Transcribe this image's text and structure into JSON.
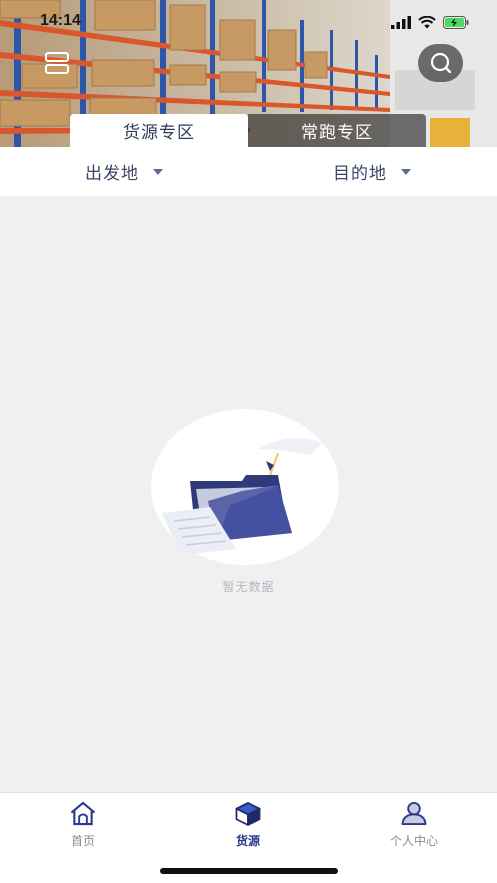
{
  "status_bar": {
    "time": "14:14"
  },
  "header": {
    "tabs": [
      {
        "label": "货源专区",
        "active": true
      },
      {
        "label": "常跑专区",
        "active": false
      }
    ],
    "menu_icon": "list-icon",
    "search_icon": "search-icon"
  },
  "filters": {
    "origin": "出发地",
    "destination": "目的地"
  },
  "empty_state": {
    "message": "暂无数据",
    "illustration": "empty-folder-illustration"
  },
  "tabbar": {
    "items": [
      {
        "label": "首页",
        "icon": "home-icon",
        "active": false
      },
      {
        "label": "货源",
        "icon": "box-icon",
        "active": true
      },
      {
        "label": "个人中心",
        "icon": "user-icon",
        "active": false
      }
    ]
  },
  "colors": {
    "accent": "#2a3b8f",
    "background": "#f0f0f0",
    "tab_text": "#2e3a59",
    "filter_text": "#3c4563"
  }
}
